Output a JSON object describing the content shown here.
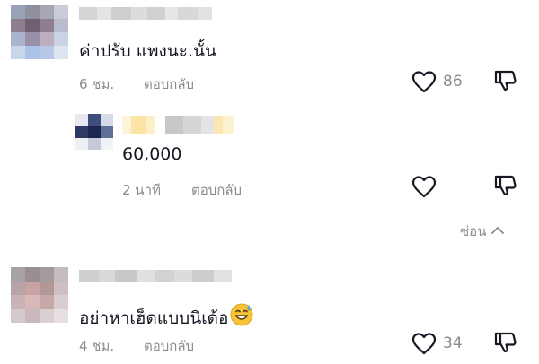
{
  "comments": [
    {
      "text": "ค่าปรับ แพงนะ.นั้น",
      "time": "6 ชม.",
      "reply_label": "ตอบกลับ",
      "likes": "86"
    },
    {
      "text": "อย่าหาเฮ็ดแบบนิเด้อ",
      "time": "4 ชม.",
      "reply_label": "ตอบกลับ",
      "likes": "34",
      "emoji": "grinning-sweat-emoji"
    }
  ],
  "reply": {
    "text": "60,000",
    "time": "2 นาที",
    "reply_label": "ตอบกลับ",
    "likes": ""
  },
  "hide_replies_label": "ซ่อน",
  "icons": {
    "like": "heart-icon",
    "dislike": "thumbs-down-icon",
    "collapse": "chevron-up-icon"
  },
  "colors": {
    "text": "#161823",
    "muted": "#8a8b91",
    "background": "#ffffff"
  }
}
